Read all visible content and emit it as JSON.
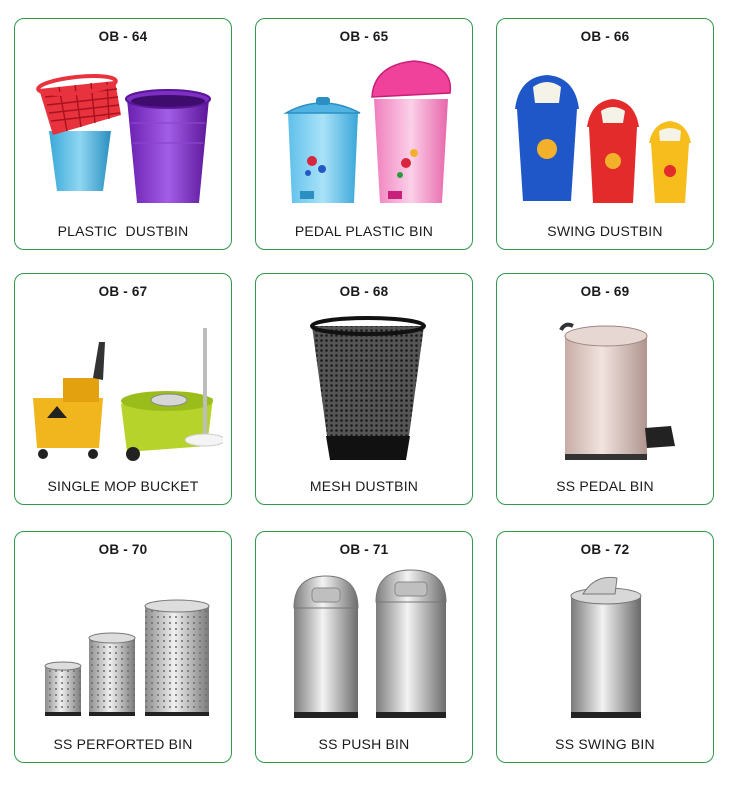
{
  "products": [
    {
      "code": "OB - 64",
      "name": "PLASTIC  DUSTBIN"
    },
    {
      "code": "OB - 65",
      "name": "PEDAL PLASTIC BIN"
    },
    {
      "code": "OB - 66",
      "name": "SWING DUSTBIN"
    },
    {
      "code": "OB - 67",
      "name": "SINGLE MOP BUCKET"
    },
    {
      "code": "OB - 68",
      "name": "MESH DUSTBIN"
    },
    {
      "code": "OB - 69",
      "name": "SS PEDAL BIN"
    },
    {
      "code": "OB - 70",
      "name": "SS PERFORTED BIN"
    },
    {
      "code": "OB - 71",
      "name": "SS PUSH BIN"
    },
    {
      "code": "OB - 72",
      "name": "SS SWING BIN"
    }
  ],
  "colors": {
    "border": "#2f9a4a",
    "text": "#1a1a1a"
  },
  "icons": [
    "plastic-dustbin-icon",
    "pedal-plastic-bin-icon",
    "swing-dustbin-icon",
    "mop-bucket-icon",
    "mesh-dustbin-icon",
    "ss-pedal-bin-icon",
    "ss-perforated-bin-icon",
    "ss-push-bin-icon",
    "ss-swing-bin-icon"
  ]
}
